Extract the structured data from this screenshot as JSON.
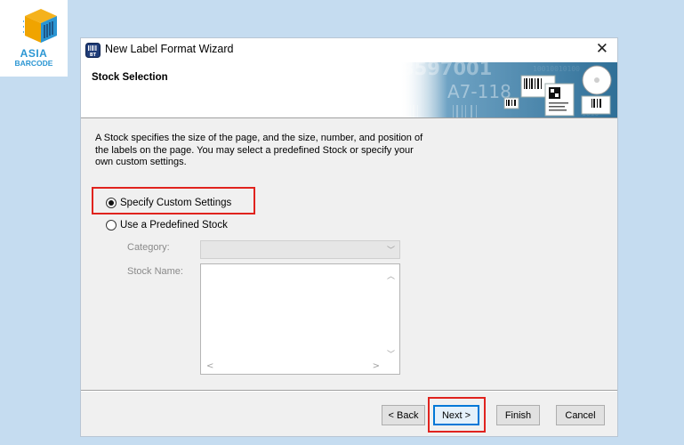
{
  "logo": {
    "line1": "ASIA",
    "line2": "BARCODE"
  },
  "window": {
    "title": "New Label Format Wizard",
    "close_glyph": "✕"
  },
  "header": {
    "step_title": "Stock Selection",
    "banner_text_1": "3597001",
    "banner_text_2": "A7-118"
  },
  "description": "A Stock specifies the size of the page, and the size, number, and position of the labels on the page. You may select a predefined Stock or specify your own custom settings.",
  "options": [
    {
      "label": "Specify Custom Settings",
      "checked": true
    },
    {
      "label": "Use a Predefined Stock",
      "checked": false
    }
  ],
  "fields": {
    "category_label": "Category:",
    "stock_name_label": "Stock Name:"
  },
  "buttons": {
    "back": "< Back",
    "next": "Next >",
    "finish": "Finish",
    "cancel": "Cancel"
  },
  "colors": {
    "background": "#c5dcf0",
    "highlight": "#e0231e",
    "logo_blue": "#2b96d3"
  },
  "icons": [
    "app-icon",
    "close-icon",
    "chevron-down-icon",
    "chevron-up-icon",
    "chevron-left-icon",
    "chevron-right-icon"
  ]
}
